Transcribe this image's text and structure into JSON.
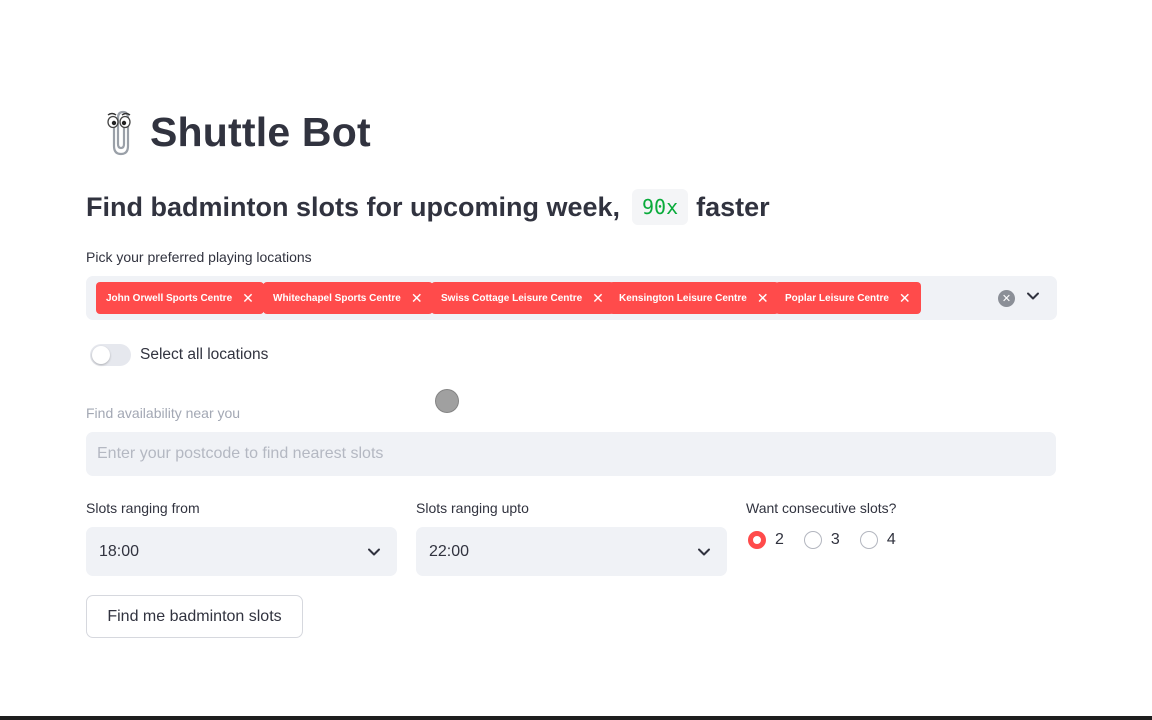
{
  "app": {
    "title": "Shuttle Bot",
    "title_icon": "paperclip-assistant-icon",
    "subtitle_prefix": "Find badminton slots for upcoming week,",
    "subtitle_code": "90x",
    "subtitle_suffix": "faster"
  },
  "locations": {
    "label": "Pick your preferred playing locations",
    "selected": [
      "John Orwell Sports Centre",
      "Whitechapel Sports Centre",
      "Swiss Cottage Leisure Centre",
      "Kensington Leisure Centre",
      "Poplar Leisure Centre"
    ],
    "remove_glyph": "✕",
    "clear_glyph": "✕"
  },
  "select_all": {
    "label": "Select all locations",
    "checked": false
  },
  "postcode": {
    "label": "Find availability near you",
    "placeholder": "Enter your postcode to find nearest slots",
    "value": ""
  },
  "slots_from": {
    "label": "Slots ranging from",
    "value": "18:00"
  },
  "slots_upto": {
    "label": "Slots ranging upto",
    "value": "22:00"
  },
  "consecutive": {
    "label": "Want consecutive slots?",
    "options": [
      "2",
      "3",
      "4"
    ],
    "selected": "2"
  },
  "submit": {
    "label": "Find me badminton slots"
  },
  "colors": {
    "accent": "#ff4b4b",
    "code_green": "#09ab3b",
    "input_bg": "#f0f2f6",
    "text": "#31333f"
  }
}
